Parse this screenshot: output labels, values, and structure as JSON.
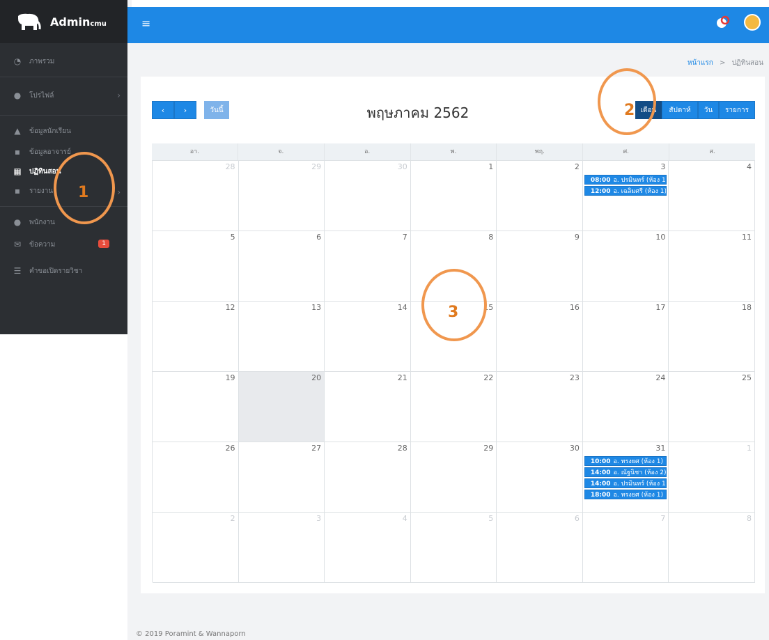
{
  "brand": {
    "name": "Admin",
    "name_suffix": "cmu"
  },
  "sidebar": {
    "items": [
      {
        "label": "ภาพรวม",
        "icon": "dashboard-icon"
      },
      {
        "label": "โปรไฟล์",
        "icon": "user-circle-icon"
      },
      {
        "label": "ข้อมูลนักเรียน",
        "icon": "graduation-cap-icon"
      },
      {
        "label": "ข้อมูลอาจารย์",
        "icon": "id-card-icon"
      },
      {
        "label": "ปฏิทินสอน",
        "icon": "calendar-icon"
      },
      {
        "label": "รายงาน",
        "icon": "report-icon"
      },
      {
        "label": "พนักงาน",
        "icon": "person-icon"
      },
      {
        "label": "ข้อความ",
        "icon": "envelope-icon",
        "badge": "1"
      },
      {
        "label": "คำขอเปิดรายวิชา",
        "icon": "list-icon"
      }
    ]
  },
  "breadcrumb": {
    "home": "หน้าแรก",
    "separator": ">",
    "current": "ปฏิทินสอน"
  },
  "calendar": {
    "title": "พฤษภาคม 2562",
    "today_label": "วันนี้",
    "views": [
      "เดือน",
      "สัปดาห์",
      "วัน",
      "รายการ"
    ],
    "weekdays": [
      "อา.",
      "จ.",
      "อ.",
      "พ.",
      "พฤ.",
      "ศ.",
      "ส."
    ],
    "weeks": [
      [
        {
          "day": "28",
          "other": true
        },
        {
          "day": "29",
          "other": true
        },
        {
          "day": "30",
          "other": true
        },
        {
          "day": "1"
        },
        {
          "day": "2"
        },
        {
          "day": "3",
          "events": [
            {
              "time": "08:00",
              "title": "อ. ปรมินทร์ (ห้อง 1)"
            },
            {
              "time": "12:00",
              "title": "อ. เฉลิมศรี (ห้อง 1)"
            }
          ]
        },
        {
          "day": "4"
        }
      ],
      [
        {
          "day": "5"
        },
        {
          "day": "6"
        },
        {
          "day": "7"
        },
        {
          "day": "8"
        },
        {
          "day": "9"
        },
        {
          "day": "10"
        },
        {
          "day": "11"
        }
      ],
      [
        {
          "day": "12"
        },
        {
          "day": "13"
        },
        {
          "day": "14"
        },
        {
          "day": "15"
        },
        {
          "day": "16"
        },
        {
          "day": "17"
        },
        {
          "day": "18"
        }
      ],
      [
        {
          "day": "19"
        },
        {
          "day": "20",
          "today": true
        },
        {
          "day": "21"
        },
        {
          "day": "22"
        },
        {
          "day": "23"
        },
        {
          "day": "24"
        },
        {
          "day": "25"
        }
      ],
      [
        {
          "day": "26"
        },
        {
          "day": "27"
        },
        {
          "day": "28"
        },
        {
          "day": "29"
        },
        {
          "day": "30"
        },
        {
          "day": "31",
          "events": [
            {
              "time": "10:00",
              "title": "อ. ทรงยศ (ห้อง 1)"
            },
            {
              "time": "14:00",
              "title": "อ. ณัฐนิชา (ห้อง 2)"
            },
            {
              "time": "14:00",
              "title": "อ. ปรมินทร์ (ห้อง 1)"
            },
            {
              "time": "18:00",
              "title": "อ. ทรงยศ (ห้อง 1)"
            }
          ]
        },
        {
          "day": "1",
          "other": true
        }
      ],
      [
        {
          "day": "2",
          "other": true
        },
        {
          "day": "3",
          "other": true
        },
        {
          "day": "4",
          "other": true
        },
        {
          "day": "5",
          "other": true
        },
        {
          "day": "6",
          "other": true
        },
        {
          "day": "7",
          "other": true
        },
        {
          "day": "8",
          "other": true
        }
      ]
    ]
  },
  "annotations": [
    "1",
    "2",
    "3"
  ],
  "footer": "© 2019 Poramint & Wannaporn",
  "colors": {
    "accent": "#1e88e5",
    "sidebar": "#2c2f33",
    "marker": "#f0974e"
  }
}
